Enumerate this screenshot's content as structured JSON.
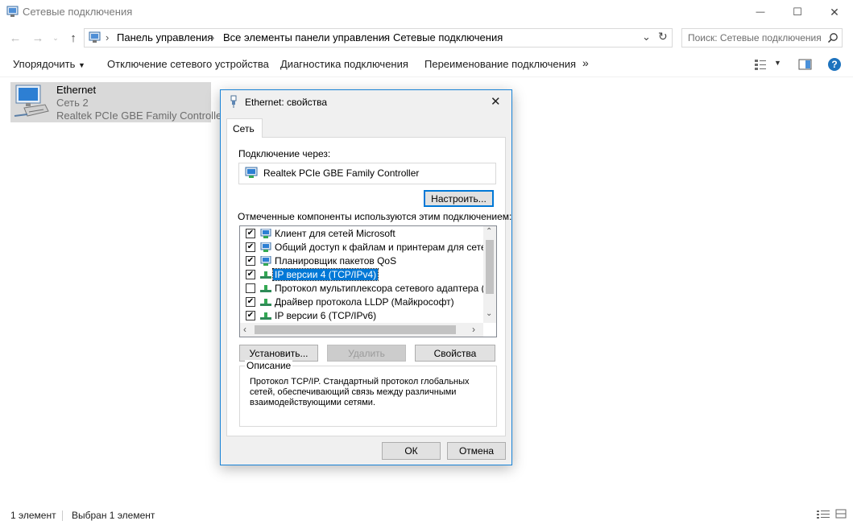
{
  "window": {
    "title": "Сетевые подключения",
    "minimize": "—",
    "maximize": "☐",
    "close": "✕"
  },
  "address": {
    "crumbs": [
      "Панель управления",
      "Все элементы панели управления",
      "Сетевые подключения"
    ],
    "search_placeholder": "Поиск: Сетевые подключения"
  },
  "toolbar": {
    "organize": "Упорядочить",
    "disable_device": "Отключение сетевого устройства",
    "diagnostics": "Диагностика подключения",
    "rename": "Переименование подключения",
    "more": "»"
  },
  "connection": {
    "name": "Ethernet",
    "network": "Сеть  2",
    "adapter": "Realtek PCIe GBE Family Controller"
  },
  "status_bar": {
    "count": "1 элемент",
    "selected": "Выбран 1 элемент"
  },
  "dialog": {
    "title": "Ethernet: свойства",
    "close": "✕",
    "tab": "Сеть",
    "connect_using_label": "Подключение через:",
    "adapter": "Realtek PCIe GBE Family Controller",
    "configure": "Настроить...",
    "components_label": "Отмеченные компоненты используются этим подключением:",
    "components": [
      {
        "label": "Клиент для сетей Microsoft",
        "checked": true,
        "icon": "network-client-icon"
      },
      {
        "label": "Общий доступ к файлам и принтерам для сетей Mi",
        "checked": true,
        "icon": "network-service-icon"
      },
      {
        "label": "Планировщик пакетов QoS",
        "checked": true,
        "icon": "network-service-icon"
      },
      {
        "label": "IP версии 4 (TCP/IPv4)",
        "checked": true,
        "icon": "protocol-icon",
        "selected": true
      },
      {
        "label": "Протокол мультиплексора сетевого адаптера (Май",
        "checked": false,
        "icon": "protocol-icon"
      },
      {
        "label": "Драйвер протокола LLDP (Майкрософт)",
        "checked": true,
        "icon": "protocol-icon"
      },
      {
        "label": "IP версии 6 (TCP/IPv6)",
        "checked": true,
        "icon": "protocol-icon"
      }
    ],
    "install": "Установить...",
    "uninstall": "Удалить",
    "properties": "Свойства",
    "description_title": "Описание",
    "description": "Протокол TCP/IP. Стандартный протокол глобальных сетей, обеспечивающий связь между различными взаимодействующими сетями.",
    "ok": "ОК",
    "cancel": "Отмена"
  },
  "colors": {
    "accent": "#0078d7",
    "selection_bg": "#d9d9d9",
    "dialog_bg": "#f0f0f0"
  }
}
